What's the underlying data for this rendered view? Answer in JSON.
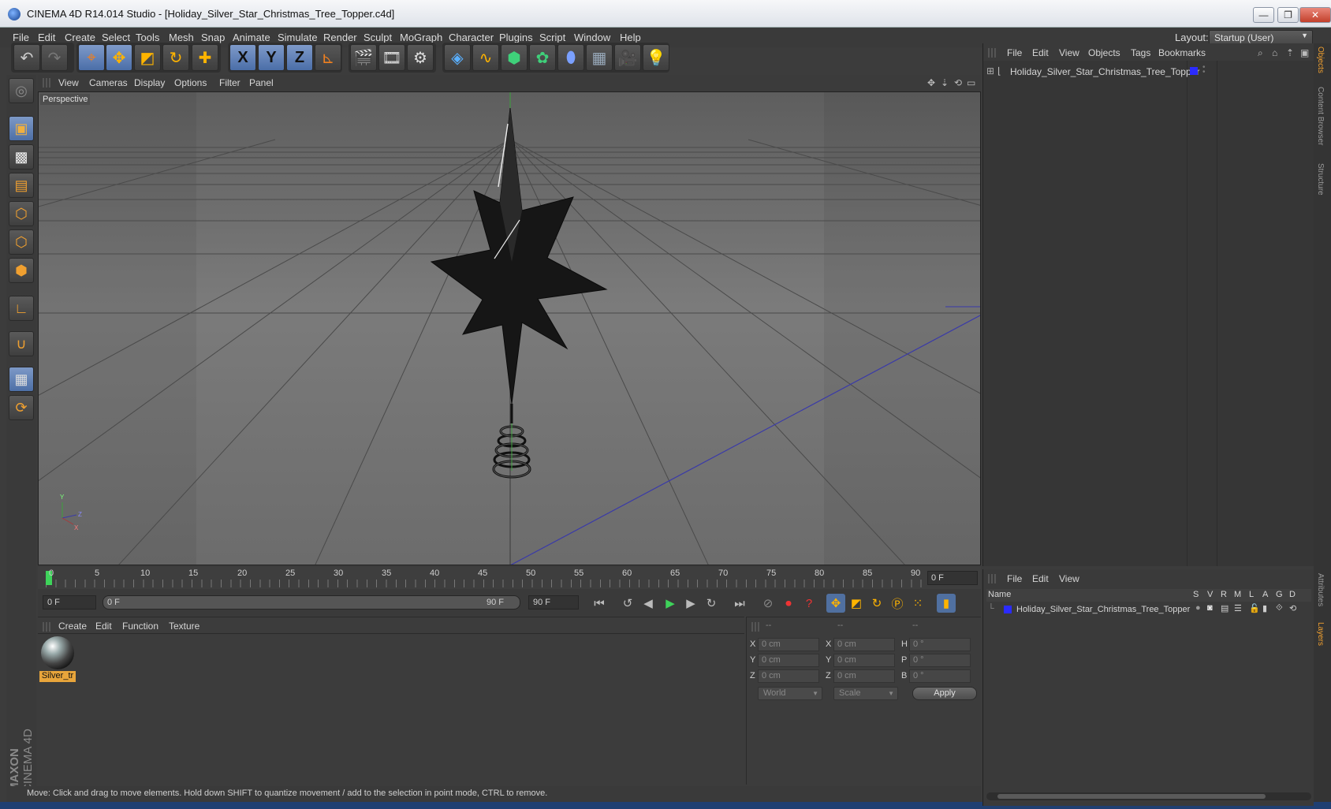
{
  "window": {
    "title": "CINEMA 4D R14.014 Studio - [Holiday_Silver_Star_Christmas_Tree_Topper.c4d]",
    "min": "—",
    "max": "❐",
    "close": "✕"
  },
  "menu": [
    "File",
    "Edit",
    "Create",
    "Select",
    "Tools",
    "Mesh",
    "Snap",
    "Animate",
    "Simulate",
    "Render",
    "Sculpt",
    "MoGraph",
    "Character",
    "Plugins",
    "Script",
    "Window",
    "Help"
  ],
  "layout": {
    "label": "Layout:",
    "value": "Startup (User)"
  },
  "toolbar": {
    "icons": [
      "undo-icon",
      "redo-icon",
      "live-select-icon",
      "move-icon",
      "scale-icon",
      "rotate-icon",
      "add-icon",
      "x-axis-icon",
      "y-axis-icon",
      "z-axis-icon",
      "coordinate-system-icon",
      "render-view-icon",
      "render-picture-viewer-icon",
      "render-settings-icon",
      "cube-icon",
      "spline-icon",
      "nurbs-icon",
      "mograph-icon",
      "deformer-icon",
      "floor-icon",
      "camera-icon",
      "light-icon"
    ],
    "x": "X",
    "y": "Y",
    "z": "Z"
  },
  "viewport": {
    "menu": [
      "View",
      "Cameras",
      "Display",
      "Options",
      "Filter",
      "Panel"
    ],
    "label": "Perspective"
  },
  "timeline": {
    "ticks": [
      "0",
      "5",
      "10",
      "15",
      "20",
      "25",
      "30",
      "35",
      "40",
      "45",
      "50",
      "55",
      "60",
      "65",
      "70",
      "75",
      "80",
      "85",
      "90"
    ],
    "current_frame": "0 F",
    "start": "0 F",
    "range_start": "0 F",
    "range_end": "90 F",
    "end": "90 F"
  },
  "material_manager": {
    "menu": [
      "Create",
      "Edit",
      "Function",
      "Texture"
    ],
    "material": "Silver_tr"
  },
  "coordinates": {
    "headers": [
      "--",
      "--",
      "--"
    ],
    "rows": [
      {
        "a": "X",
        "av": "0 cm",
        "b": "X",
        "bv": "0 cm",
        "c": "H",
        "cv": "0 °"
      },
      {
        "a": "Y",
        "av": "0 cm",
        "b": "Y",
        "bv": "0 cm",
        "c": "P",
        "cv": "0 °"
      },
      {
        "a": "Z",
        "av": "0 cm",
        "b": "Z",
        "bv": "0 cm",
        "c": "B",
        "cv": "0 °"
      }
    ],
    "space": "World",
    "mode": "Scale",
    "apply": "Apply"
  },
  "status": "Move: Click and drag to move elements. Hold down SHIFT to quantize movement / add to the selection in point mode, CTRL to remove.",
  "object_manager": {
    "menu": [
      "File",
      "Edit",
      "View",
      "Objects",
      "Tags",
      "Bookmarks"
    ],
    "object": "Holiday_Silver_Star_Christmas_Tree_Topper",
    "layer_color": "#2b2bff"
  },
  "layer_manager": {
    "menu": [
      "File",
      "Edit",
      "View"
    ],
    "columns": [
      "Name",
      "S",
      "V",
      "R",
      "M",
      "L",
      "A",
      "G",
      "D"
    ],
    "object": "Holiday_Silver_Star_Christmas_Tree_Topper"
  },
  "side_tabs": [
    "Objects",
    "Content Browser",
    "Structure",
    "Attributes",
    "Layers"
  ],
  "branding": {
    "vendor": "MAXON",
    "product": "CINEMA 4D"
  }
}
